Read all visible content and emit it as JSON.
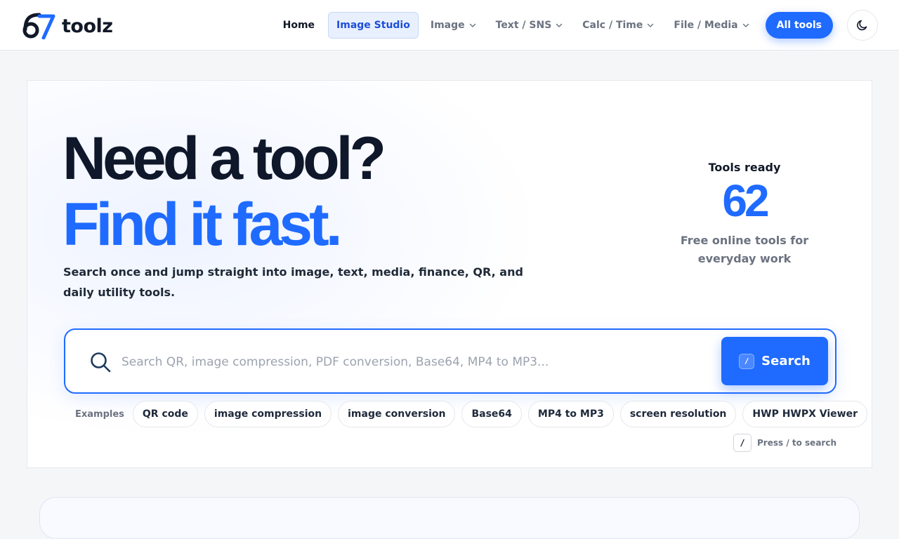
{
  "brand": {
    "name": "toolz",
    "mark": "67"
  },
  "nav": {
    "items": [
      {
        "label": "Home"
      },
      {
        "label": "Image Studio"
      },
      {
        "label": "Image"
      },
      {
        "label": "Text / SNS"
      },
      {
        "label": "Calc / Time"
      },
      {
        "label": "File / Media"
      }
    ],
    "all_tools": "All tools",
    "theme_toggle_icon": "moon-icon"
  },
  "hero": {
    "title_line1": "Need a tool?",
    "title_line2": "Find it fast.",
    "subtitle": "Search once and jump straight into image, text, media, finance, QR, and daily utility tools.",
    "stats": {
      "label": "Tools ready",
      "count": "62",
      "description": "Free online tools for everyday work"
    }
  },
  "search": {
    "placeholder": "Search QR, image compression, PDF conversion, Base64, MP4 to MP3...",
    "value": "",
    "button_label": "Search",
    "button_key": "/",
    "examples_label": "Examples",
    "examples": [
      "QR code",
      "image compression",
      "image conversion",
      "Base64",
      "MP4 to MP3",
      "screen resolution",
      "HWP HWPX Viewer"
    ],
    "hint_key": "/",
    "hint_text": "Press / to search"
  },
  "colors": {
    "accent": "#1f6bff",
    "heading": "#0f172a",
    "muted": "#6b7280",
    "studio_bg": "#e8f0fe"
  }
}
